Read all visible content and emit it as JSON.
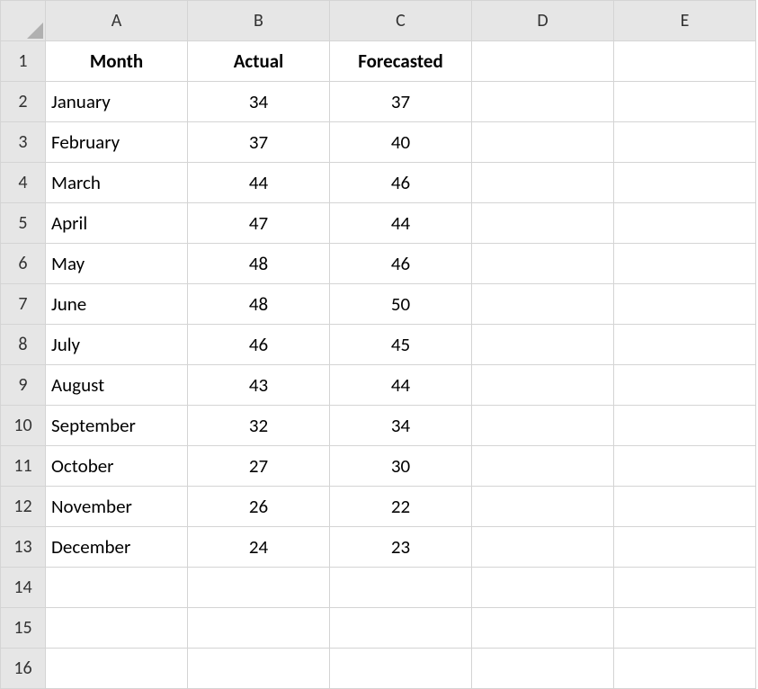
{
  "columns": [
    "A",
    "B",
    "C",
    "D",
    "E"
  ],
  "row_count": 16,
  "headers": {
    "A": "Month",
    "B": "Actual",
    "C": "Forecasted"
  },
  "rows": [
    {
      "month": "January",
      "actual": "34",
      "forecasted": "37"
    },
    {
      "month": "February",
      "actual": "37",
      "forecasted": "40"
    },
    {
      "month": "March",
      "actual": "44",
      "forecasted": "46"
    },
    {
      "month": "April",
      "actual": "47",
      "forecasted": "44"
    },
    {
      "month": "May",
      "actual": "48",
      "forecasted": "46"
    },
    {
      "month": "June",
      "actual": "48",
      "forecasted": "50"
    },
    {
      "month": "July",
      "actual": "46",
      "forecasted": "45"
    },
    {
      "month": "August",
      "actual": "43",
      "forecasted": "44"
    },
    {
      "month": "September",
      "actual": "32",
      "forecasted": "34"
    },
    {
      "month": "October",
      "actual": "27",
      "forecasted": "30"
    },
    {
      "month": "November",
      "actual": "26",
      "forecasted": "22"
    },
    {
      "month": "December",
      "actual": "24",
      "forecasted": "23"
    }
  ],
  "chart_data": {
    "type": "table",
    "title": "",
    "columns": [
      "Month",
      "Actual",
      "Forecasted"
    ],
    "categories": [
      "January",
      "February",
      "March",
      "April",
      "May",
      "June",
      "July",
      "August",
      "September",
      "October",
      "November",
      "December"
    ],
    "series": [
      {
        "name": "Actual",
        "values": [
          34,
          37,
          44,
          47,
          48,
          48,
          46,
          43,
          32,
          27,
          26,
          24
        ]
      },
      {
        "name": "Forecasted",
        "values": [
          37,
          40,
          46,
          44,
          46,
          50,
          45,
          44,
          34,
          30,
          22,
          23
        ]
      }
    ]
  }
}
